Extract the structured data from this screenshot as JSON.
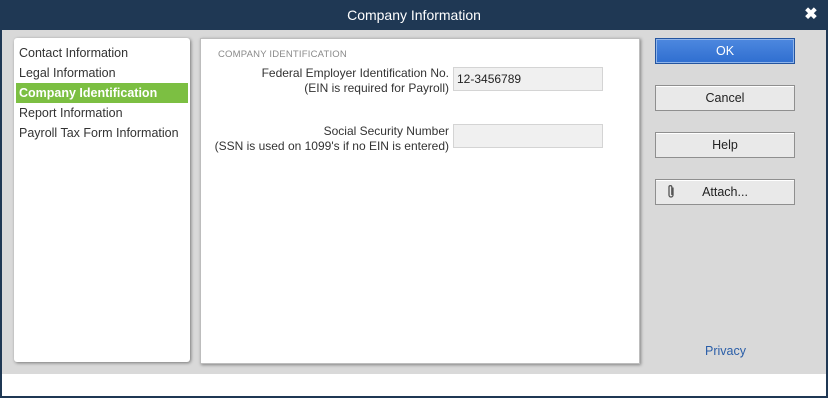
{
  "window": {
    "title": "Company Information",
    "close_glyph": "✖"
  },
  "sidebar": {
    "items": [
      {
        "label": "Contact Information",
        "selected": false
      },
      {
        "label": "Legal Information",
        "selected": false
      },
      {
        "label": "Company Identification",
        "selected": true
      },
      {
        "label": "Report Information",
        "selected": false
      },
      {
        "label": "Payroll Tax Form Information",
        "selected": false
      }
    ]
  },
  "main": {
    "section_header": "COMPANY IDENTIFICATION",
    "ein": {
      "label_line1": "Federal Employer Identification No.",
      "label_line2": "(EIN is required for Payroll)",
      "value": "12-3456789"
    },
    "ssn": {
      "label_line1": "Social Security Number",
      "label_line2": "(SSN is used on 1099's if no EIN is entered)",
      "value": ""
    }
  },
  "buttons": {
    "ok": "OK",
    "cancel": "Cancel",
    "help": "Help",
    "attach": "Attach...",
    "attach_icon": "paperclip-icon"
  },
  "links": {
    "privacy": "Privacy"
  },
  "colors": {
    "title_bar": "#1f3854",
    "selected_item": "#7cbf42",
    "primary_button": "#3a78d6",
    "link": "#2a5ea8"
  }
}
